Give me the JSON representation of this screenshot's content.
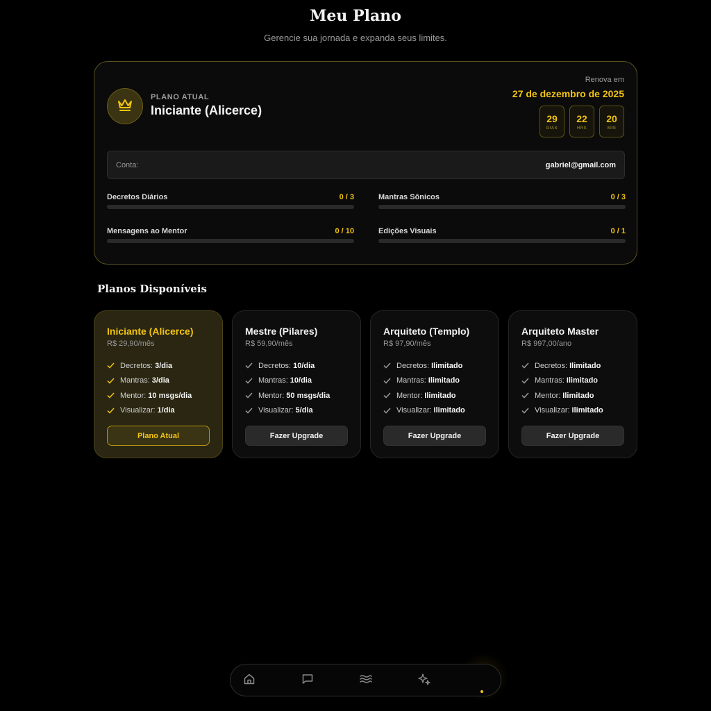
{
  "header": {
    "title": "Meu Plano",
    "subtitle": "Gerencie sua jornada e expanda seus limites."
  },
  "current_plan": {
    "eyebrow": "PLANO ATUAL",
    "name": "Iniciante (Alicerce)",
    "icon": "crown-icon",
    "renew_label": "Renova em",
    "renew_date": "27 de dezembro de 2025",
    "countdown": [
      {
        "value": "29",
        "unit": "DIAS"
      },
      {
        "value": "22",
        "unit": "HRS"
      },
      {
        "value": "20",
        "unit": "MIN"
      }
    ],
    "account_label": "Conta:",
    "account_email": "gabriel@gmail.com",
    "usage": [
      {
        "label": "Decretos Diários",
        "value": "0 / 3",
        "progress": 0
      },
      {
        "label": "Mantras Sônicos",
        "value": "0 / 3",
        "progress": 0
      },
      {
        "label": "Mensagens ao Mentor",
        "value": "0 / 10",
        "progress": 0
      },
      {
        "label": "Edições Visuais",
        "value": "0 / 1",
        "progress": 0
      }
    ]
  },
  "plans_section": {
    "title": "Planos Disponíveis",
    "plans": [
      {
        "name": "Iniciante (Alicerce)",
        "price": "R$ 29,90/mês",
        "current": true,
        "features": [
          {
            "label": "Decretos:",
            "value": "3/dia"
          },
          {
            "label": "Mantras:",
            "value": "3/dia"
          },
          {
            "label": "Mentor:",
            "value": "10 msgs/dia"
          },
          {
            "label": "Visualizar:",
            "value": "1/dia"
          }
        ],
        "button": "Plano Atual"
      },
      {
        "name": "Mestre (Pilares)",
        "price": "R$ 59,90/mês",
        "current": false,
        "features": [
          {
            "label": "Decretos:",
            "value": "10/dia"
          },
          {
            "label": "Mantras:",
            "value": "10/dia"
          },
          {
            "label": "Mentor:",
            "value": "50 msgs/dia"
          },
          {
            "label": "Visualizar:",
            "value": "5/dia"
          }
        ],
        "button": "Fazer Upgrade"
      },
      {
        "name": "Arquiteto (Templo)",
        "price": "R$ 97,90/mês",
        "current": false,
        "features": [
          {
            "label": "Decretos:",
            "value": "Ilimitado"
          },
          {
            "label": "Mantras:",
            "value": "Ilimitado"
          },
          {
            "label": "Mentor:",
            "value": "Ilimitado"
          },
          {
            "label": "Visualizar:",
            "value": "Ilimitado"
          }
        ],
        "button": "Fazer Upgrade"
      },
      {
        "name": "Arquiteto Master",
        "price": "R$ 997,00/ano",
        "current": false,
        "features": [
          {
            "label": "Decretos:",
            "value": "Ilimitado"
          },
          {
            "label": "Mantras:",
            "value": "Ilimitado"
          },
          {
            "label": "Mentor:",
            "value": "Ilimitado"
          },
          {
            "label": "Visualizar:",
            "value": "Ilimitado"
          }
        ],
        "button": "Fazer Upgrade"
      }
    ]
  },
  "bottom_nav": {
    "items": [
      "home-icon",
      "chat-icon",
      "waves-icon",
      "sparkles-icon",
      "plan-icon"
    ],
    "active": 4
  },
  "colors": {
    "accent": "#f2c413",
    "background": "#000000",
    "card": "#0b0b0b",
    "current_card": "#2a2612"
  }
}
